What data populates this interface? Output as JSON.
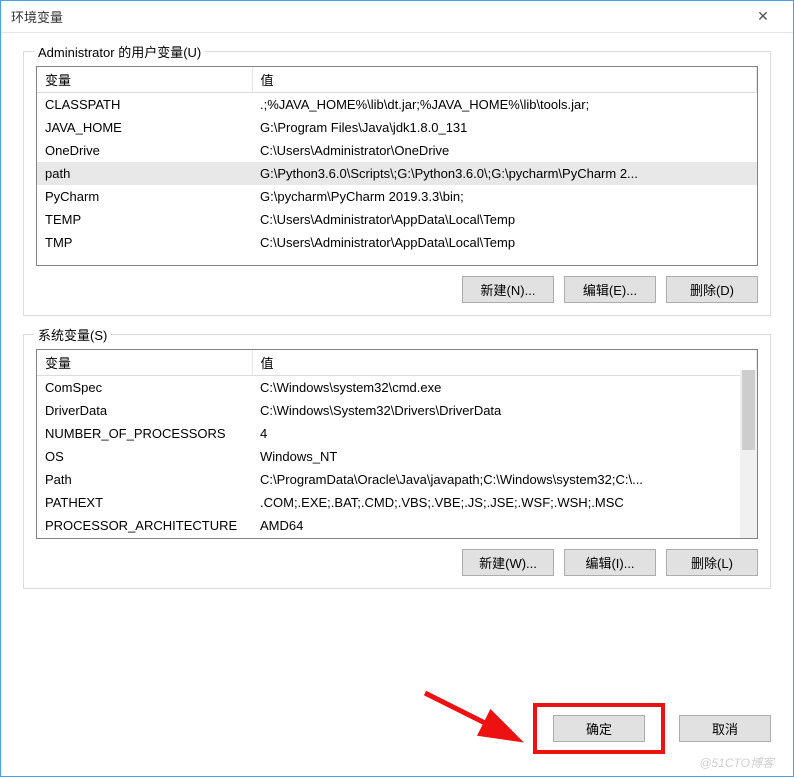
{
  "window": {
    "title": "环境变量",
    "close_glyph": "✕"
  },
  "user_group": {
    "legend": "Administrator 的用户变量(U)",
    "col_var": "变量",
    "col_val": "值",
    "rows": [
      {
        "name": "CLASSPATH",
        "value": ".;%JAVA_HOME%\\lib\\dt.jar;%JAVA_HOME%\\lib\\tools.jar;"
      },
      {
        "name": "JAVA_HOME",
        "value": "G:\\Program Files\\Java\\jdk1.8.0_131"
      },
      {
        "name": "OneDrive",
        "value": "C:\\Users\\Administrator\\OneDrive"
      },
      {
        "name": "path",
        "value": "G:\\Python3.6.0\\Scripts\\;G:\\Python3.6.0\\;G:\\pycharm\\PyCharm 2..."
      },
      {
        "name": "PyCharm",
        "value": "G:\\pycharm\\PyCharm 2019.3.3\\bin;"
      },
      {
        "name": "TEMP",
        "value": "C:\\Users\\Administrator\\AppData\\Local\\Temp"
      },
      {
        "name": "TMP",
        "value": "C:\\Users\\Administrator\\AppData\\Local\\Temp"
      }
    ],
    "selected_index": 3,
    "buttons": {
      "new": "新建(N)...",
      "edit": "编辑(E)...",
      "delete": "删除(D)"
    }
  },
  "sys_group": {
    "legend": "系统变量(S)",
    "col_var": "变量",
    "col_val": "值",
    "rows": [
      {
        "name": "ComSpec",
        "value": "C:\\Windows\\system32\\cmd.exe"
      },
      {
        "name": "DriverData",
        "value": "C:\\Windows\\System32\\Drivers\\DriverData"
      },
      {
        "name": "NUMBER_OF_PROCESSORS",
        "value": "4"
      },
      {
        "name": "OS",
        "value": "Windows_NT"
      },
      {
        "name": "Path",
        "value": "C:\\ProgramData\\Oracle\\Java\\javapath;C:\\Windows\\system32;C:\\..."
      },
      {
        "name": "PATHEXT",
        "value": ".COM;.EXE;.BAT;.CMD;.VBS;.VBE;.JS;.JSE;.WSF;.WSH;.MSC"
      },
      {
        "name": "PROCESSOR_ARCHITECTURE",
        "value": "AMD64"
      }
    ],
    "buttons": {
      "new": "新建(W)...",
      "edit": "编辑(I)...",
      "delete": "删除(L)"
    }
  },
  "footer": {
    "ok": "确定",
    "cancel": "取消"
  },
  "watermark": "@51CTO博客"
}
